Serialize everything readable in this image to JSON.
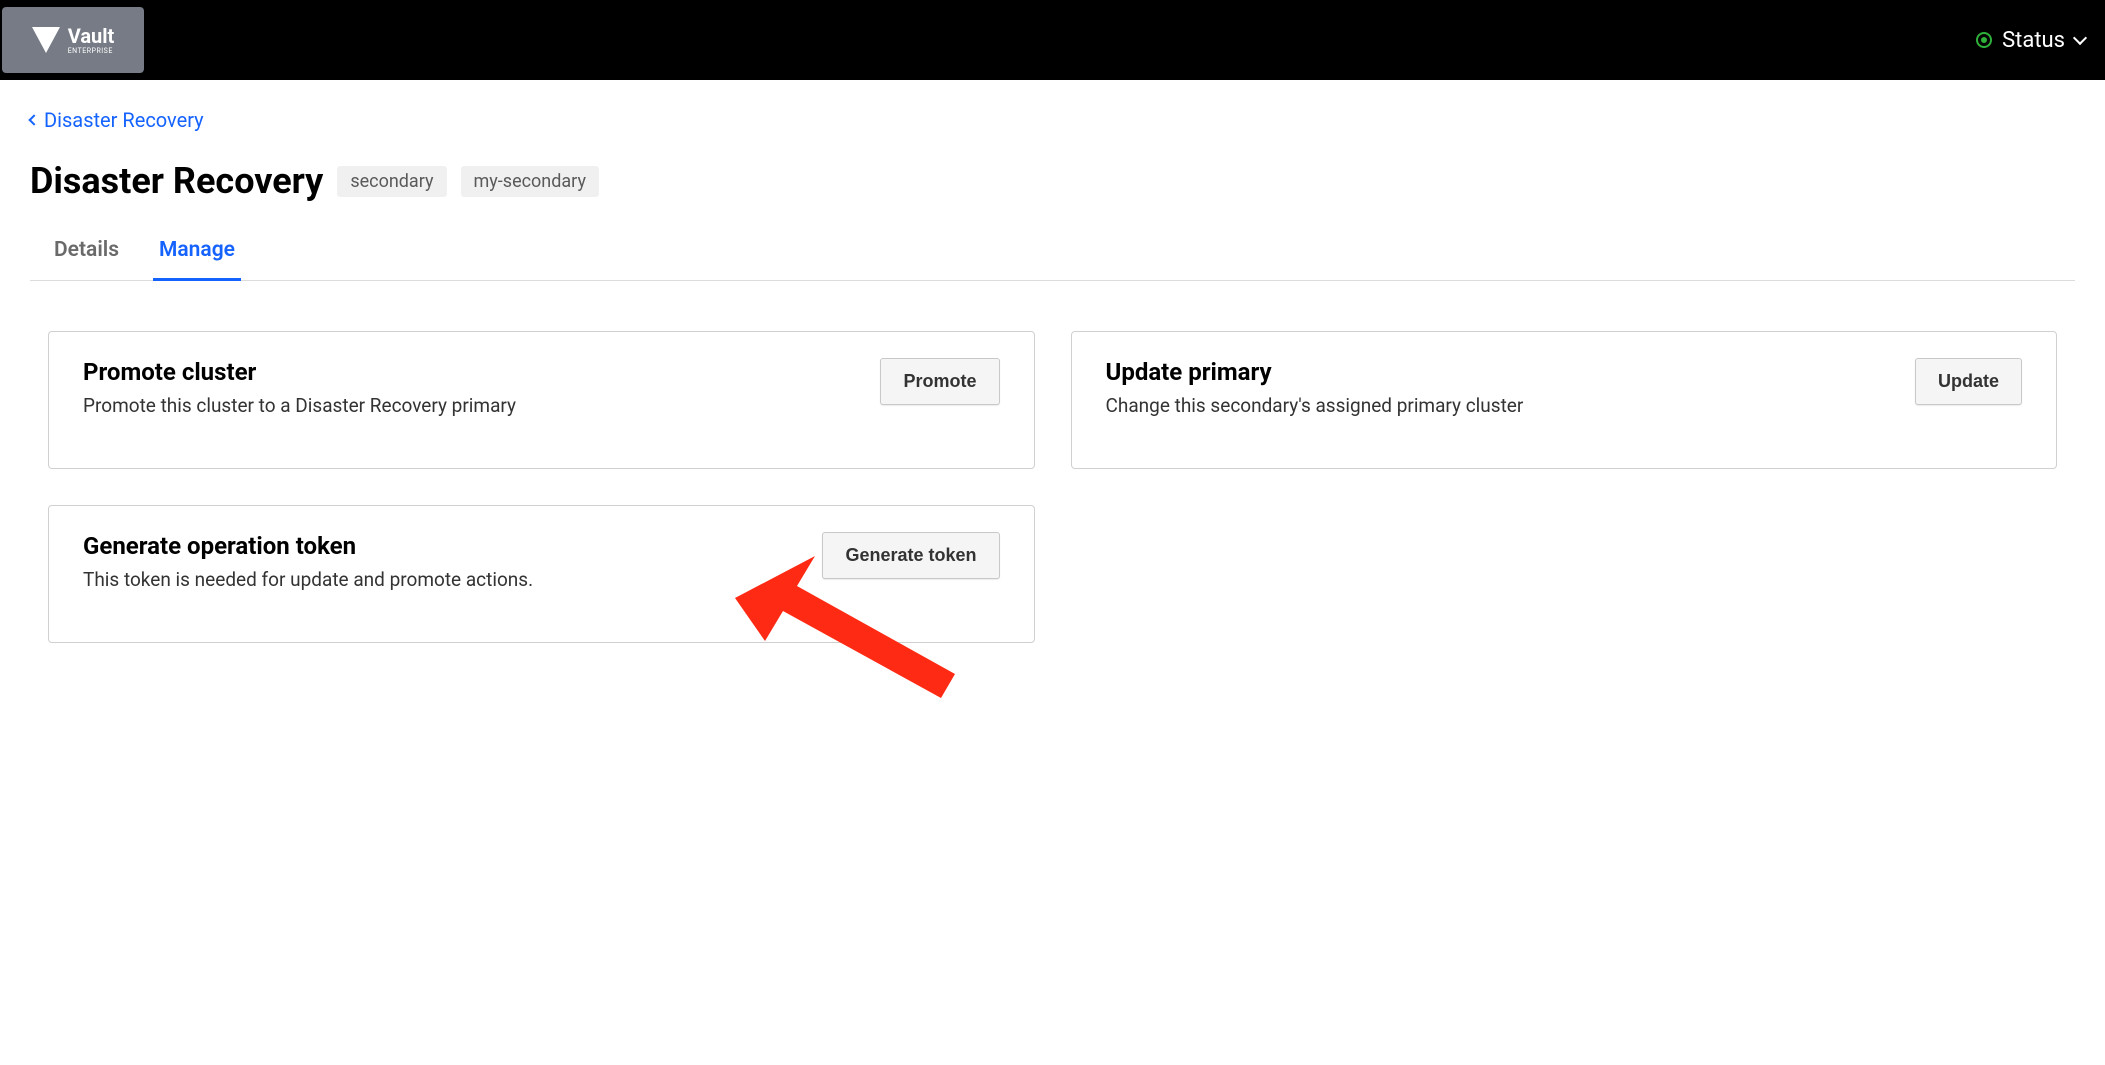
{
  "header": {
    "logo_main": "Vault",
    "logo_sub": "ENTERPRISE",
    "status_label": "Status"
  },
  "breadcrumb": {
    "text": "Disaster Recovery"
  },
  "page": {
    "title": "Disaster Recovery",
    "badge_role": "secondary",
    "badge_name": "my-secondary"
  },
  "tabs": [
    {
      "label": "Details",
      "active": false
    },
    {
      "label": "Manage",
      "active": true
    }
  ],
  "cards": {
    "promote": {
      "title": "Promote cluster",
      "desc": "Promote this cluster to a Disaster Recovery primary",
      "button": "Promote"
    },
    "update": {
      "title": "Update primary",
      "desc": "Change this secondary's assigned primary cluster",
      "button": "Update"
    },
    "generate": {
      "title": "Generate operation token",
      "desc": "This token is needed for update and promote actions.",
      "button": "Generate token"
    }
  }
}
